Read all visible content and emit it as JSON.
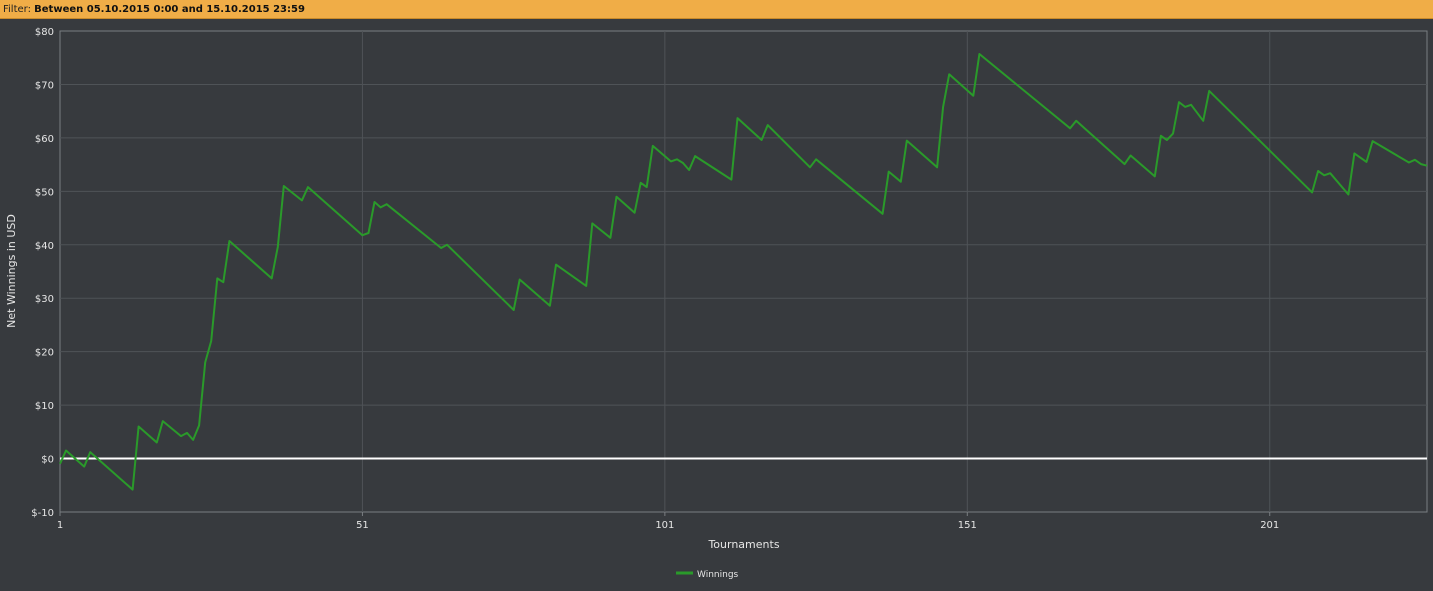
{
  "filter": {
    "label": "Filter:",
    "value": "Between 05.10.2015 0:00 and 15.10.2015 23:59"
  },
  "colors": {
    "background": "#373a3e",
    "plot_background": "#373a3e",
    "grid": "#4f5357",
    "series": "#2a9a2a",
    "zero_line": "#ffffff",
    "filter_bar": "#f0ad47"
  },
  "chart_data": {
    "type": "line",
    "xlabel": "Tournaments",
    "ylabel": "Net Winnings in USD",
    "xlim": [
      1,
      227
    ],
    "ylim": [
      -10,
      80
    ],
    "x_ticks": [
      1,
      51,
      101,
      151,
      201
    ],
    "y_ticks": [
      -10,
      0,
      10,
      20,
      30,
      40,
      50,
      60,
      70,
      80
    ],
    "y_tick_labels": [
      "$-10",
      "$0",
      "$10",
      "$20",
      "$30",
      "$40",
      "$50",
      "$60",
      "$70",
      "$80"
    ],
    "grid": true,
    "legend": "bottom-center",
    "zero_line": true,
    "series": [
      {
        "name": "Winnings",
        "x": [
          1,
          2,
          5,
          6,
          13,
          14,
          17,
          18,
          21,
          22,
          23,
          24,
          25,
          26,
          27,
          28,
          29,
          36,
          37,
          38,
          41,
          42,
          51,
          52,
          53,
          54,
          55,
          64,
          65,
          76,
          77,
          82,
          83,
          88,
          89,
          92,
          93,
          96,
          97,
          98,
          99,
          102,
          103,
          104,
          105,
          106,
          112,
          113,
          117,
          118,
          125,
          126,
          137,
          138,
          140,
          141,
          146,
          147,
          148,
          152,
          153,
          168,
          169,
          177,
          178,
          182,
          183,
          184,
          185,
          186,
          187,
          188,
          190,
          191,
          208,
          209,
          210,
          211,
          214,
          215,
          217,
          218,
          224,
          225,
          226,
          227
        ],
        "y": [
          -1,
          1.5,
          -1.5,
          1.2,
          -5.8,
          6,
          3,
          7,
          4.2,
          4.8,
          3.5,
          6.2,
          18,
          22,
          33.7,
          33,
          40.7,
          33.7,
          39.6,
          51,
          48.3,
          50.8,
          41.8,
          42.2,
          48,
          47,
          47.6,
          39.4,
          40,
          27.8,
          33.5,
          28.6,
          36.3,
          32.3,
          44,
          41.3,
          49,
          46,
          51.6,
          50.8,
          58.5,
          55.6,
          56,
          55.3,
          54,
          56.6,
          52.2,
          63.7,
          59.6,
          62.4,
          54.5,
          56,
          45.8,
          53.7,
          51.8,
          59.5,
          54.5,
          65.8,
          71.9,
          67.9,
          75.7,
          61.8,
          63.2,
          55.1,
          56.7,
          52.8,
          60.4,
          59.6,
          60.8,
          66.7,
          65.8,
          66.2,
          63.2,
          68.8,
          49.8,
          53.8,
          53,
          53.4,
          49.4,
          57.1,
          55.5,
          59.4,
          55.4,
          55.9,
          55.1,
          54.8
        ]
      }
    ]
  }
}
